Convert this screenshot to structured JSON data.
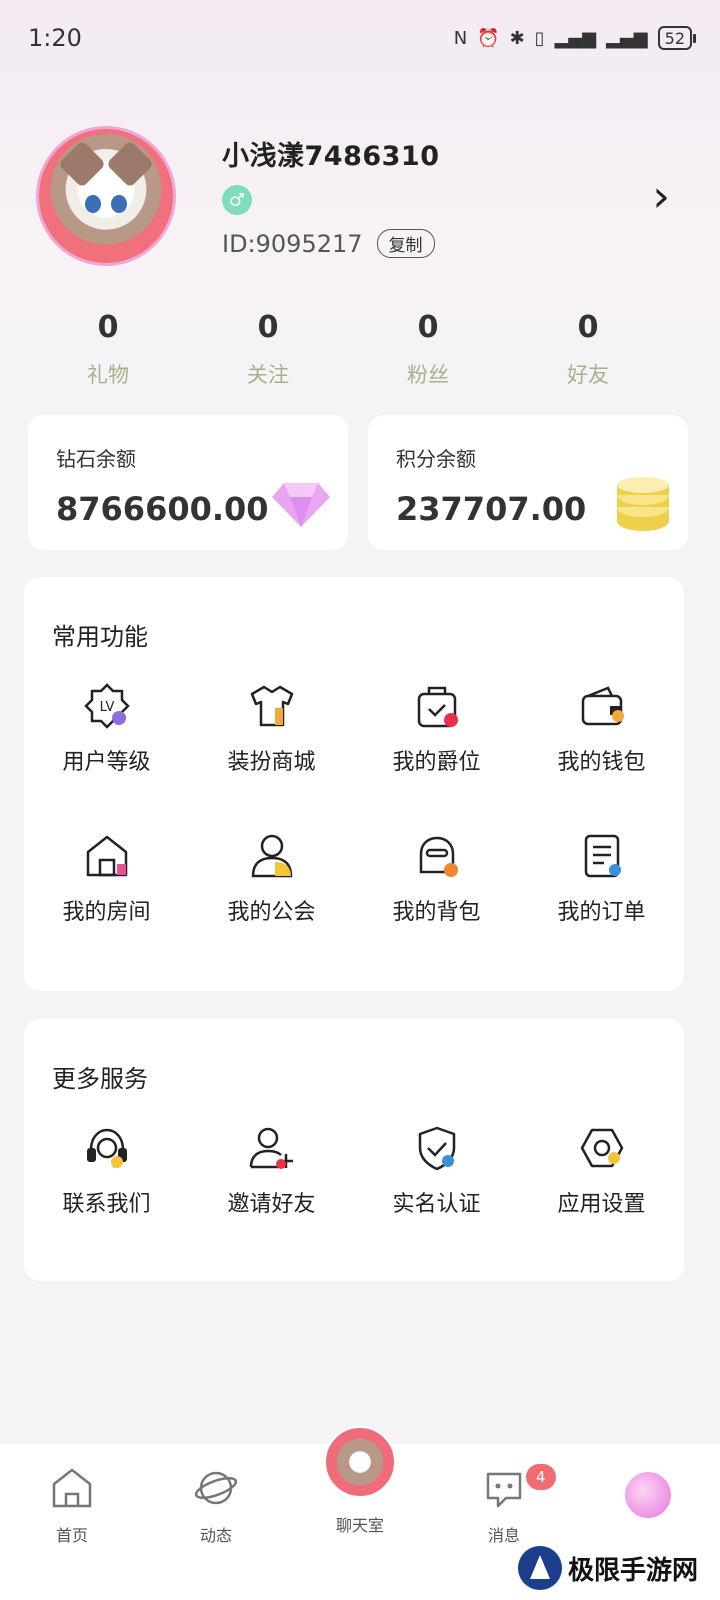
{
  "status": {
    "time": "1:20",
    "battery": "52"
  },
  "profile": {
    "username": "小浅漾7486310",
    "gender_symbol": "♂",
    "id_text": "ID:9095217",
    "copy_label": "复制"
  },
  "stats": [
    {
      "value": "0",
      "label": "礼物"
    },
    {
      "value": "0",
      "label": "关注"
    },
    {
      "value": "0",
      "label": "粉丝"
    },
    {
      "value": "0",
      "label": "好友"
    }
  ],
  "balances": {
    "diamond": {
      "label": "钻石余额",
      "value": "8766600.00"
    },
    "points": {
      "label": "积分余额",
      "value": "237707.00"
    }
  },
  "common_functions": {
    "title": "常用功能",
    "items": [
      {
        "label": "用户等级",
        "icon": "level-badge-icon"
      },
      {
        "label": "装扮商城",
        "icon": "tshirt-icon"
      },
      {
        "label": "我的爵位",
        "icon": "peerage-bag-icon"
      },
      {
        "label": "我的钱包",
        "icon": "wallet-icon"
      },
      {
        "label": "我的房间",
        "icon": "room-icon"
      },
      {
        "label": "我的公会",
        "icon": "guild-user-icon"
      },
      {
        "label": "我的背包",
        "icon": "backpack-icon"
      },
      {
        "label": "我的订单",
        "icon": "order-doc-icon"
      }
    ]
  },
  "more_services": {
    "title": "更多服务",
    "items": [
      {
        "label": "联系我们",
        "icon": "headset-icon"
      },
      {
        "label": "邀请好友",
        "icon": "add-friend-icon"
      },
      {
        "label": "实名认证",
        "icon": "shield-check-icon"
      },
      {
        "label": "应用设置",
        "icon": "settings-hex-icon"
      }
    ]
  },
  "nav": {
    "home": "首页",
    "moments": "动态",
    "chatroom": "聊天室",
    "messages": "消息",
    "messages_badge": "4"
  },
  "watermark": {
    "text": "极限手游网"
  },
  "colors": {
    "accent_green": "#7fdcbc",
    "stat_label": "#a8b28a",
    "badge": "#f06c73"
  }
}
